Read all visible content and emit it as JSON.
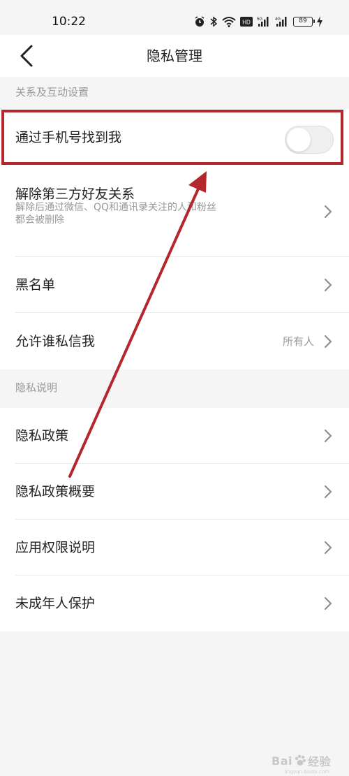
{
  "status_bar": {
    "time": "10:22",
    "battery": "89",
    "icons": [
      "alarm-icon",
      "bluetooth-icon",
      "wifi-icon",
      "hd-icon",
      "signal-5g-icon",
      "signal-4g-icon",
      "battery-icon",
      "charging-icon"
    ],
    "hd_label": "HD",
    "signal1_label": "5G",
    "signal2_label": "4G"
  },
  "header": {
    "title": "隐私管理",
    "back_icon": "chevron-left-icon"
  },
  "sections": {
    "relations": {
      "title": "关系及互动设置"
    },
    "privacy_info": {
      "title": "隐私说明"
    }
  },
  "rows": {
    "find_by_phone": {
      "label": "通过手机号找到我",
      "toggle_on": false
    },
    "remove_third_party": {
      "label": "解除第三方好友关系",
      "sub_line1": "解除后通过微信、QQ和通讯录关注的人和粉丝",
      "sub_line2": "都会被删除"
    },
    "blacklist": {
      "label": "黑名单"
    },
    "who_can_message": {
      "label": "允许谁私信我",
      "value": "所有人"
    },
    "privacy_policy": {
      "label": "隐私政策"
    },
    "privacy_summary": {
      "label": "隐私政策概要"
    },
    "app_permissions": {
      "label": "应用权限说明"
    },
    "minor_protection": {
      "label": "未成年人保护"
    }
  },
  "annotation": {
    "highlight_color": "#b3282d",
    "arrow_color": "#b3282d"
  },
  "watermark": {
    "text_left": "Bai",
    "text_right": "经验",
    "url": "jingyan.baidu.com"
  },
  "colors": {
    "background": "#f5f5f5",
    "surface": "#ffffff",
    "secondary_text": "#999999"
  }
}
